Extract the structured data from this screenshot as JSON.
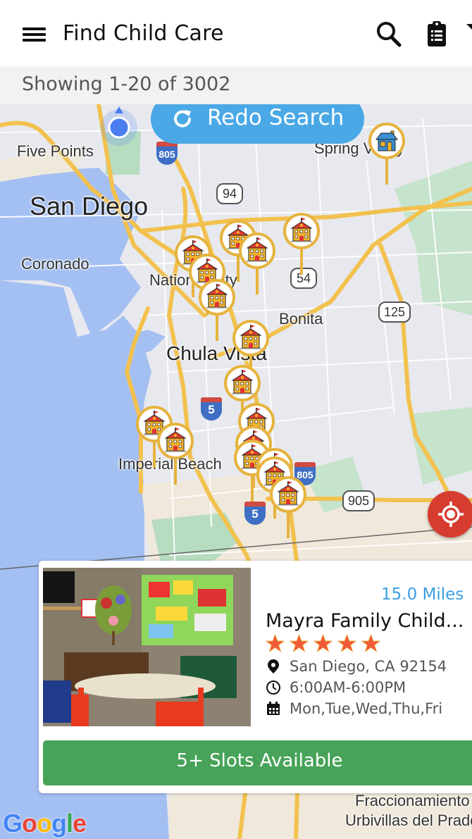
{
  "header": {
    "title": "Find Child Care",
    "icons": [
      "menu-icon",
      "search-icon",
      "clipboard-list-icon",
      "filter-icon"
    ]
  },
  "results": {
    "text": "Showing 1-20 of 3002"
  },
  "map": {
    "redo_search_label": "Redo Search",
    "labels": {
      "five_points": "Five Points",
      "san_diego": "San Diego",
      "coronado": "Coronado",
      "national_city": "National City",
      "bonita": "Bonita",
      "chula_vista": "Chula Vista",
      "imperial_beach": "Imperial Beach",
      "spring_valley": "Spring Valley",
      "fraccionamiento": "Fraccionamiento",
      "urbivillas": "Urbivillas del Prado"
    },
    "route_shields": {
      "i805_top": "805",
      "sr94": "94",
      "sr54": "54",
      "sr125": "125",
      "i5_mid": "5",
      "i805_bottom": "805",
      "i5_bottom": "5",
      "sr905": "905"
    },
    "google_logo": "Google",
    "pin_types": [
      "school",
      "house"
    ],
    "pin_count": 18
  },
  "card": {
    "distance": "15.0 Miles",
    "name": "Mayra Family Child...",
    "rating": 5,
    "rating_max": 5,
    "location": "San Diego, CA 92154",
    "hours": "6:00AM-6:00PM",
    "days": "Mon,Tue,Wed,Thu,Fri",
    "slots_label": "5+ Slots Available"
  },
  "colors": {
    "accent_blue": "#4aa8e6",
    "pin_gold": "#e6b33e",
    "locate_red": "#d63c2f",
    "slots_green": "#48a35a",
    "star_orange": "#f05a3a"
  }
}
